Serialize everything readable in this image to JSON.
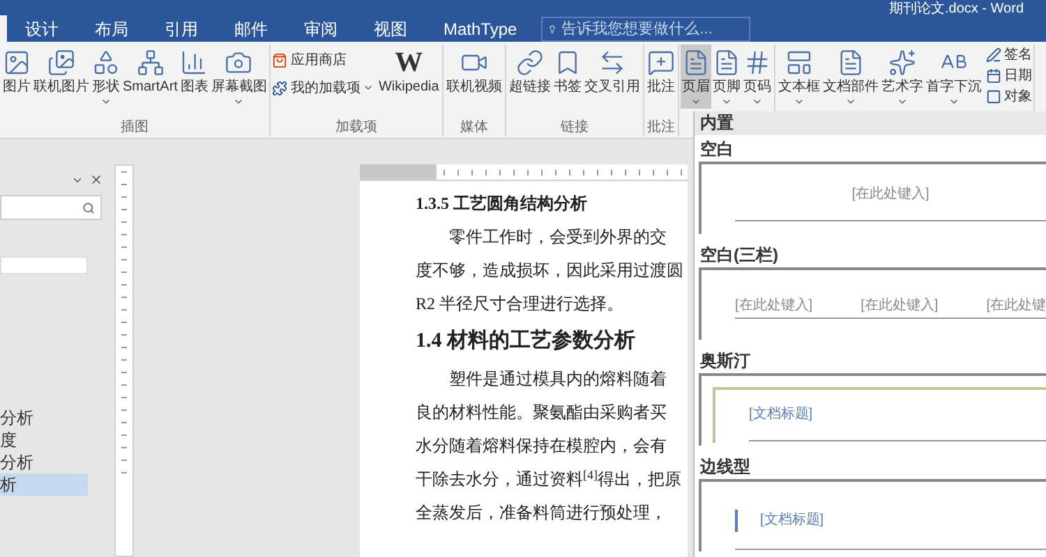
{
  "window": {
    "title": "期刊论文.docx - Word"
  },
  "tabs": [
    {
      "label": "设计",
      "selected": false
    },
    {
      "label": "布局",
      "selected": false
    },
    {
      "label": "引用",
      "selected": false
    },
    {
      "label": "邮件",
      "selected": false
    },
    {
      "label": "审阅",
      "selected": false
    },
    {
      "label": "视图",
      "selected": false
    },
    {
      "label": "MathType",
      "selected": false
    }
  ],
  "tell_me": {
    "placeholder": "告诉我您想要做什么..."
  },
  "ribbon_groups": [
    {
      "label": "插图",
      "buttons": [
        {
          "label": "图片",
          "dropdown": false,
          "selected": false
        },
        {
          "label": "联机图片",
          "dropdown": false,
          "selected": false
        },
        {
          "label": "形状",
          "dropdown": true,
          "selected": false
        },
        {
          "label": "SmartArt",
          "dropdown": false,
          "selected": false
        },
        {
          "label": "图表",
          "dropdown": false,
          "selected": false
        },
        {
          "label": "屏幕截图",
          "dropdown": true,
          "selected": false
        }
      ]
    },
    {
      "label": "加载项",
      "kind": "addins",
      "small": [
        {
          "label": "应用商店",
          "dropdown": false
        },
        {
          "label": "我的加载项",
          "dropdown": true
        }
      ],
      "buttons": [
        {
          "label": "Wikipedia",
          "logo": "W",
          "dropdown": false,
          "selected": false
        }
      ]
    },
    {
      "label": "媒体",
      "buttons": [
        {
          "label": "联机视频",
          "dropdown": false,
          "selected": false
        }
      ]
    },
    {
      "label": "链接",
      "buttons": [
        {
          "label": "超链接",
          "dropdown": false,
          "selected": false
        },
        {
          "label": "书签",
          "dropdown": false,
          "selected": false
        },
        {
          "label": "交叉引用",
          "dropdown": false,
          "selected": false
        }
      ]
    },
    {
      "label": "批注",
      "buttons": [
        {
          "label": "批注",
          "dropdown": false,
          "selected": false
        }
      ]
    },
    {
      "buttons": [
        {
          "label": "页眉",
          "dropdown": true,
          "selected": true
        },
        {
          "label": "页脚",
          "dropdown": true,
          "selected": false
        },
        {
          "label": "页码",
          "dropdown": true,
          "selected": false
        }
      ]
    },
    {
      "kind": "text",
      "buttons": [
        {
          "label": "文本框",
          "dropdown": true,
          "selected": false
        },
        {
          "label": "文档部件",
          "dropdown": true,
          "selected": false
        },
        {
          "label": "艺术字",
          "dropdown": true,
          "selected": false
        },
        {
          "label": "首字下沉",
          "dropdown": true,
          "selected": false
        }
      ],
      "small": [
        {
          "label": "签名",
          "dropdown": false
        },
        {
          "label": "日期",
          "dropdown": false
        },
        {
          "label": "对象",
          "dropdown": false
        }
      ]
    }
  ],
  "nav_pane": {
    "items": [
      {
        "label": "分析",
        "selected": false
      },
      {
        "label": "度",
        "selected": false
      },
      {
        "label": "分析",
        "selected": false
      },
      {
        "label": "析",
        "selected": true
      }
    ]
  },
  "document": [
    {
      "kind": "h3",
      "text": "1.3.5 工艺圆角结构分析"
    },
    {
      "kind": "indent",
      "text": "零件工作时，会受到外界的交"
    },
    {
      "kind": "p",
      "text": "度不够，造成损坏，因此采用过渡圆"
    },
    {
      "kind": "p",
      "text": "R2 半径尺寸合理进行选择。"
    },
    {
      "kind": "h2",
      "text": "1.4 材料的工艺参数分析"
    },
    {
      "kind": "indent",
      "text": "塑件是通过模具内的熔料随着"
    },
    {
      "kind": "p",
      "text": "良的材料性能。聚氨酯由采购者买"
    },
    {
      "kind": "p",
      "text": "水分随着熔料保持在模腔内，会有"
    },
    {
      "kind": "p",
      "text": "干除去水分，通过资料$^{[4]}$得出，把原"
    },
    {
      "kind": "p",
      "text": "全蒸发后，准备料筒进行预处理，"
    }
  ],
  "gallery": {
    "header": "内置",
    "items": [
      {
        "label": "空白",
        "kind": "single",
        "placeholders": [
          "[在此处键入]"
        ]
      },
      {
        "label": "空白(三栏)",
        "kind": "three",
        "placeholders": [
          "[在此处键入]",
          "[在此处键入]",
          "[在此处键"
        ]
      },
      {
        "label": "奥斯汀",
        "kind": "framed",
        "placeholders": [
          "[文档标题]"
        ]
      },
      {
        "label": "边线型",
        "kind": "sideline",
        "placeholders": [
          "[文档标题]"
        ]
      }
    ]
  }
}
